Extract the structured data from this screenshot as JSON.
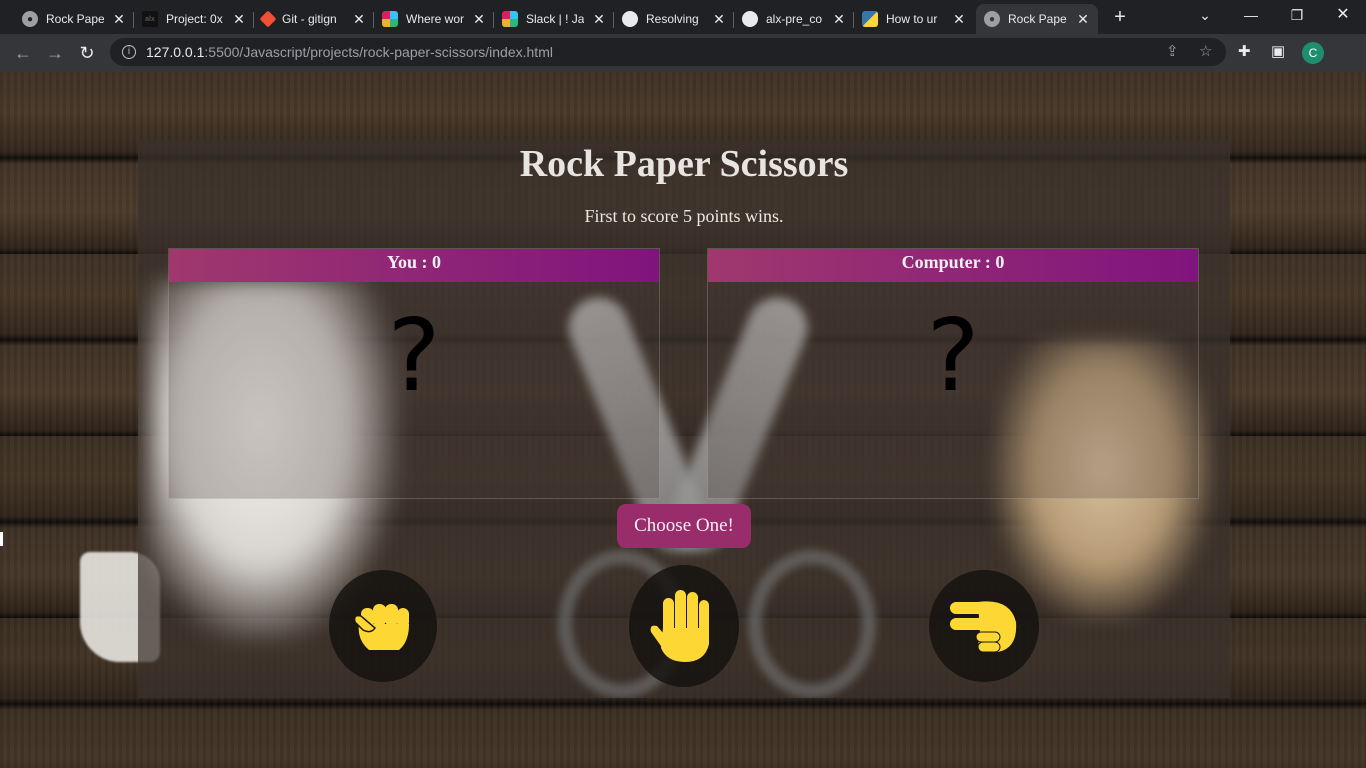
{
  "browser": {
    "tabs": [
      {
        "title": "Rock Paper",
        "icon": "globe-icon"
      },
      {
        "title": "Project: 0x",
        "icon": "alx-icon"
      },
      {
        "title": "Git - gitign",
        "icon": "git-icon"
      },
      {
        "title": "Where wor",
        "icon": "slack-icon"
      },
      {
        "title": "Slack | ! Ja",
        "icon": "slack-icon"
      },
      {
        "title": "Resolving",
        "icon": "github-icon"
      },
      {
        "title": "alx-pre_co",
        "icon": "github-icon"
      },
      {
        "title": "How to ur",
        "icon": "python-icon"
      },
      {
        "title": "Rock Pape",
        "icon": "globe-icon",
        "active": true
      }
    ],
    "close_glyph": "✕",
    "new_tab_glyph": "+",
    "url_host": "127.0.0.1",
    "url_path": ":5500/Javascript/projects/rock-paper-scissors/index.html",
    "profile_initial": "C",
    "accent": "#1e8e6e"
  },
  "game": {
    "title": "Rock Paper Scissors",
    "subtitle": "First to score 5 points wins.",
    "player": {
      "label": "You : 0",
      "choice": "?"
    },
    "computer": {
      "label": "Computer : 0",
      "choice": "?"
    },
    "choose_label": "Choose One!",
    "options": [
      "rock",
      "paper",
      "scissors"
    ],
    "colors": {
      "header_from": "#a0386e",
      "header_to": "#80147e",
      "button": "#992c6b",
      "hand": "#fdd835"
    }
  }
}
